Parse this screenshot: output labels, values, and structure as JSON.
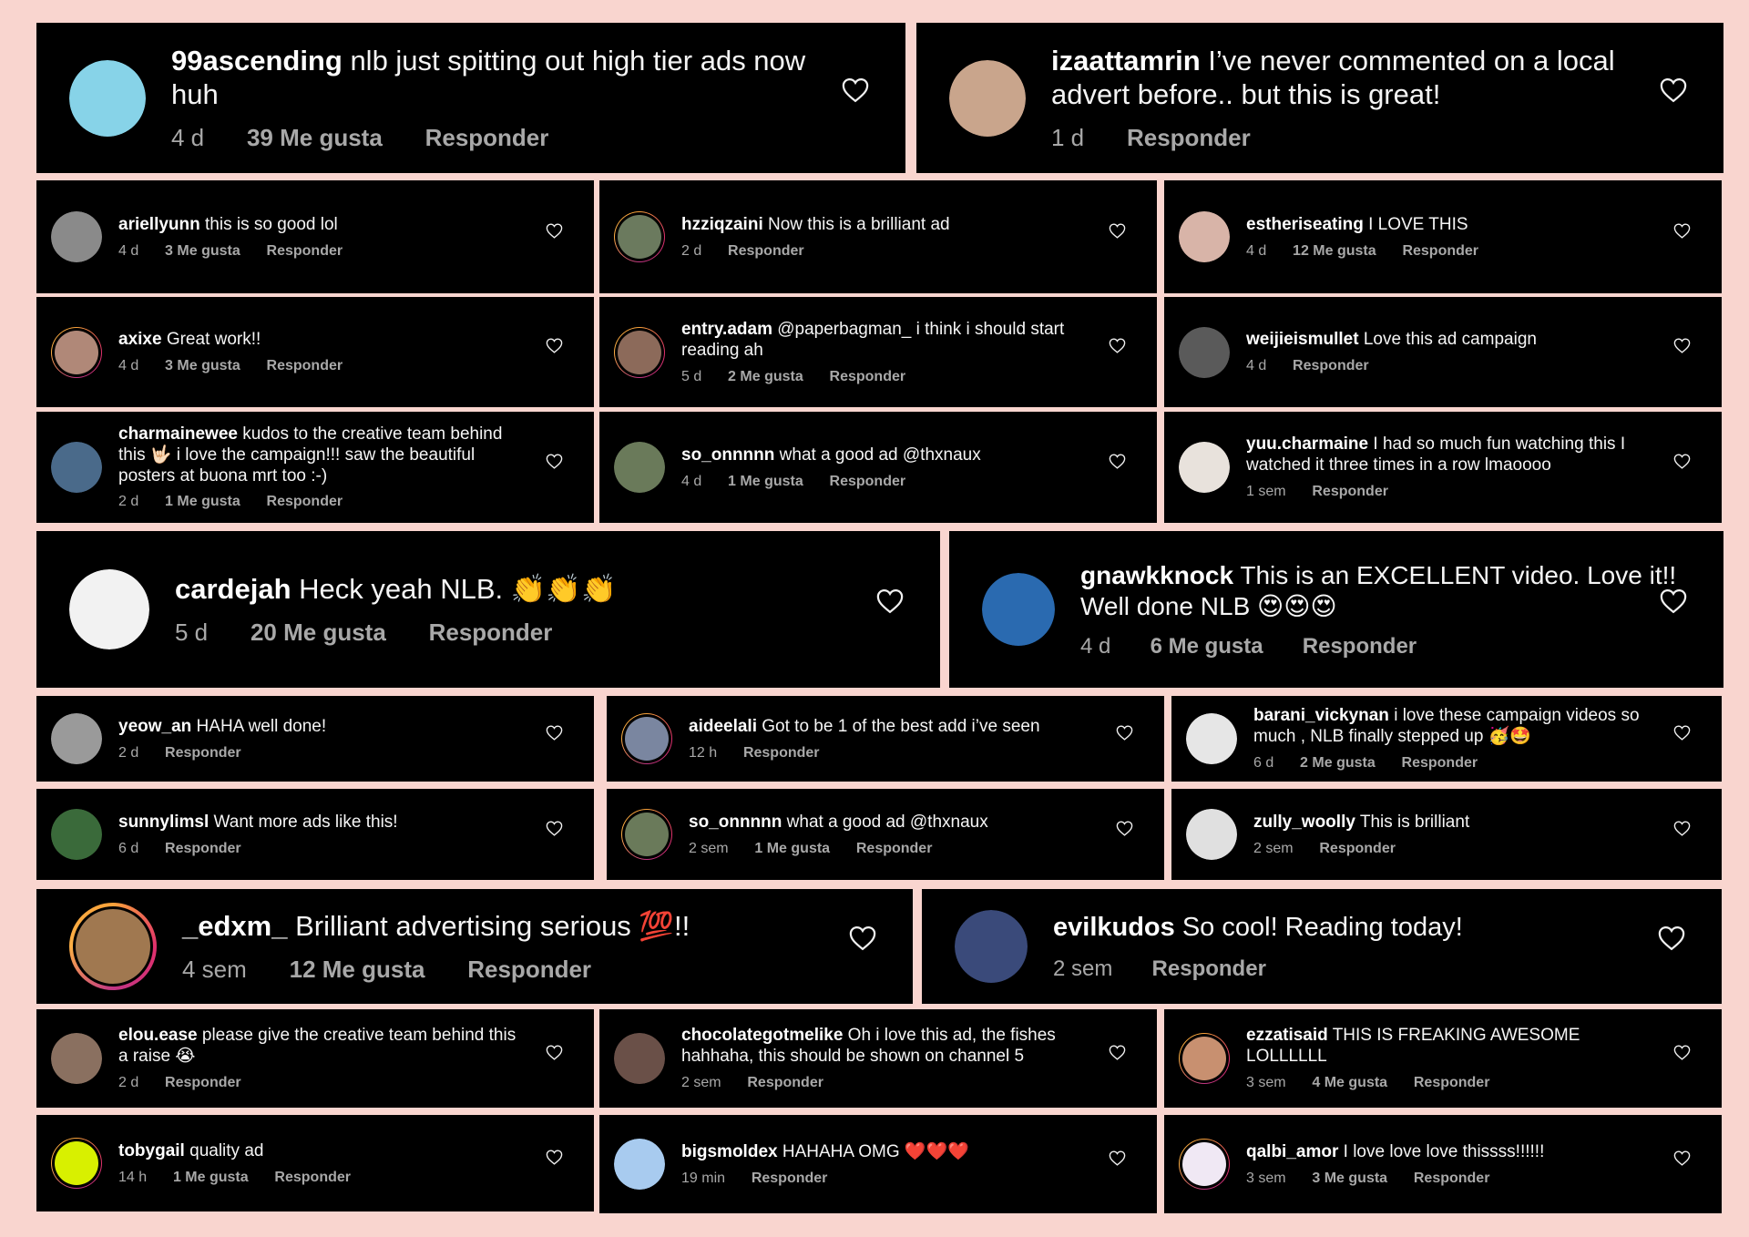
{
  "reply_label": "Responder",
  "likes_suffix": "Me gusta",
  "comments": [
    {
      "username": "99ascending",
      "text": "nlb just spitting out high tier ads now huh",
      "time": "4 d",
      "likes": "39 Me gusta",
      "reply": "Responder",
      "avatar_color": "#87d3e8"
    },
    {
      "username": "izaattamrin",
      "text": "I’ve never commented on a local advert before.. but this is great!",
      "time": "1 d",
      "likes": "",
      "reply": "Responder",
      "avatar_color": "#c9a58c"
    },
    {
      "username": "ariellyunn",
      "text": "this is so good lol",
      "time": "4 d",
      "likes": "3 Me gusta",
      "reply": "Responder",
      "avatar_color": "#8a8a8a"
    },
    {
      "username": "hzziqzaini",
      "text": "Now this is a brilliant ad",
      "time": "2 d",
      "likes": "",
      "reply": "Responder",
      "avatar_color": "#6b7a5e"
    },
    {
      "username": "estheriseating",
      "text": "I LOVE THIS",
      "time": "4 d",
      "likes": "12 Me gusta",
      "reply": "Responder",
      "avatar_color": "#d8b4a8"
    },
    {
      "username": "axixe",
      "text": "Great work!!",
      "time": "4 d",
      "likes": "3 Me gusta",
      "reply": "Responder",
      "avatar_color": "#b08878"
    },
    {
      "username": "entry.adam",
      "text": "@paperbagman_ i think i should start reading ah",
      "time": "5 d",
      "likes": "2 Me gusta",
      "reply": "Responder",
      "avatar_color": "#8c6a5a"
    },
    {
      "username": "weijieismullet",
      "text": "Love this ad campaign",
      "time": "4 d",
      "likes": "",
      "reply": "Responder",
      "avatar_color": "#5a5a5a"
    },
    {
      "username": "charmainewee",
      "text": "kudos to the creative team behind this 🤟🏻 i love the campaign!!! saw the beautiful posters at buona mrt too :-)",
      "time": "2 d",
      "likes": "1 Me gusta",
      "reply": "Responder",
      "avatar_color": "#4a6a8a"
    },
    {
      "username": "so_onnnnn",
      "text": "what a good ad @thxnaux",
      "time": "4 d",
      "likes": "1 Me gusta",
      "reply": "Responder",
      "avatar_color": "#6a7a5a"
    },
    {
      "username": "yuu.charmaine",
      "text": "I had so much fun watching this I watched it three times in a row lmaoooo",
      "time": "1 sem",
      "likes": "",
      "reply": "Responder",
      "avatar_color": "#e8e2dc"
    },
    {
      "username": "cardejah",
      "text": "Heck yeah NLB. 👏👏👏",
      "time": "5 d",
      "likes": "20 Me gusta",
      "reply": "Responder",
      "avatar_color": "#f2f2f2"
    },
    {
      "username": "gnawkknock",
      "text": "This is an EXCELLENT video. Love it!! Well done NLB 😍😍😍",
      "time": "4 d",
      "likes": "6 Me gusta",
      "reply": "Responder",
      "avatar_color": "#2a6ab0"
    },
    {
      "username": "yeow_an",
      "text": "HAHA well done!",
      "time": "2 d",
      "likes": "",
      "reply": "Responder",
      "avatar_color": "#9a9a9a"
    },
    {
      "username": "aideelali",
      "text": "Got to be 1 of the best add i’ve seen",
      "time": "12 h",
      "likes": "",
      "reply": "Responder",
      "avatar_color": "#7a86a0"
    },
    {
      "username": "barani_vickynan",
      "text": "i love these campaign videos so much , NLB finally stepped up 🥳🤩",
      "time": "6 d",
      "likes": "2 Me gusta",
      "reply": "Responder",
      "avatar_color": "#e6e6e6"
    },
    {
      "username": "sunnylimsl",
      "text": "Want more ads like this!",
      "time": "6 d",
      "likes": "",
      "reply": "Responder",
      "avatar_color": "#3a6a3a"
    },
    {
      "username": "so_onnnnn",
      "text": "what a good ad @thxnaux",
      "time": "2 sem",
      "likes": "1 Me gusta",
      "reply": "Responder",
      "avatar_color": "#6a7a5a"
    },
    {
      "username": "zully_woolly",
      "text": "This is brilliant",
      "time": "2 sem",
      "likes": "",
      "reply": "Responder",
      "avatar_color": "#e0e0e0"
    },
    {
      "username": "_edxm_",
      "text": "Brilliant advertising serious 💯!!",
      "time": "4 sem",
      "likes": "12 Me gusta",
      "reply": "Responder",
      "avatar_color": "#a07850"
    },
    {
      "username": "evilkudos",
      "text": "So cool! Reading today!",
      "time": "2 sem",
      "likes": "",
      "reply": "Responder",
      "avatar_color": "#3a4a7a"
    },
    {
      "username": "elou.ease",
      "text": "please give the creative team behind this a raise 😭",
      "time": "2 d",
      "likes": "",
      "reply": "Responder",
      "avatar_color": "#8a7060"
    },
    {
      "username": "chocolategotmelike",
      "text": "Oh i love this ad, the fishes hahhaha, this should be shown on channel 5",
      "time": "2 sem",
      "likes": "",
      "reply": "Responder",
      "avatar_color": "#6a5048"
    },
    {
      "username": "ezzatisaid",
      "text": "THIS IS FREAKING AWESOME LOLLLLLL",
      "time": "3 sem",
      "likes": "4 Me gusta",
      "reply": "Responder",
      "avatar_color": "#c89070"
    },
    {
      "username": "tobygail",
      "text": "quality ad",
      "time": "14 h",
      "likes": "1 Me gusta",
      "reply": "Responder",
      "avatar_color": "#d8f000"
    },
    {
      "username": "bigsmoldex",
      "text": "HAHAHA OMG ❤️❤️❤️",
      "time": "19 min",
      "likes": "",
      "reply": "Responder",
      "avatar_color": "#a8cbef"
    },
    {
      "username": "qalbi_amor",
      "text": "I love love love thissss!!!!!!",
      "time": "3 sem",
      "likes": "3 Me gusta",
      "reply": "Responder",
      "avatar_color": "#f0e8f4"
    }
  ]
}
